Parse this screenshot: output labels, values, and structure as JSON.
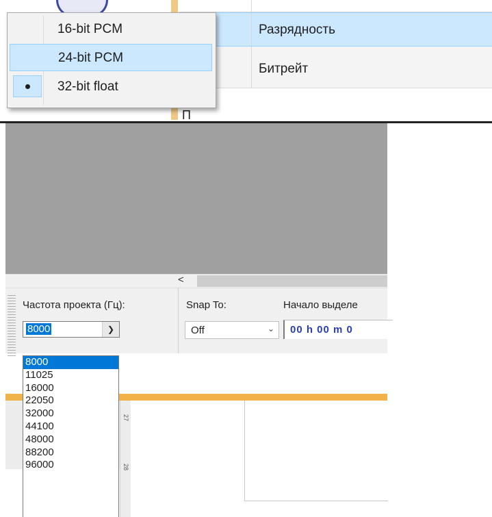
{
  "context_menu": {
    "items": [
      {
        "label": "16-bit PCM",
        "checked": false,
        "hovered": false
      },
      {
        "label": "24-bit PCM",
        "checked": false,
        "hovered": true
      },
      {
        "label": "32-bit float",
        "checked": true,
        "hovered": false
      }
    ]
  },
  "background_table": {
    "selected_row_label": "Разрядность",
    "bitrate_row_label": "Битрейт",
    "partial_bottom_text": "П"
  },
  "toolbar": {
    "project_rate_label": "Частота проекта (Гц):",
    "project_rate_value": "8000",
    "snap_to_label": "Snap To:",
    "snap_to_value": "Off",
    "selection_start_label": "Начало выделе",
    "selection_start_value": "00 h 00 m 0"
  },
  "scrollbar": {
    "left_arrow": "<"
  },
  "rate_dropdown": {
    "options": [
      "8000",
      "11025",
      "16000",
      "22050",
      "32000",
      "44100",
      "48000",
      "88200",
      "96000"
    ],
    "selected": "8000"
  },
  "ruler": {
    "ticks": [
      "27",
      "28"
    ]
  },
  "colors": {
    "menu_highlight": "#cce8ff",
    "selection_blue": "#0078d7",
    "time_text": "#2a3db0",
    "accent_orange": "#f1b349"
  }
}
